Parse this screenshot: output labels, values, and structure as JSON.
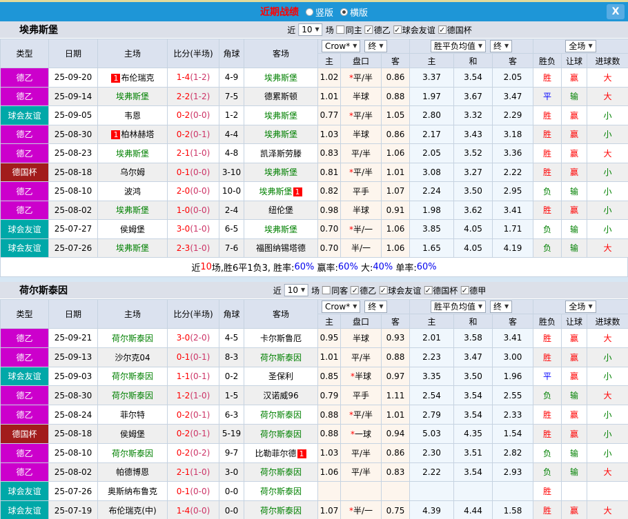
{
  "titlebar": {
    "title": "近期战绩",
    "radios": [
      {
        "label": "竖版",
        "selected": false
      },
      {
        "label": "横版",
        "selected": true
      }
    ],
    "close_icon": "X"
  },
  "headers": {
    "type": "类型",
    "date": "日期",
    "home": "主场",
    "score": "比分(半场)",
    "corner": "角球",
    "away": "客场",
    "odds_company": "Crow*",
    "odds_final": "终",
    "mean_group": "胜平负均值",
    "mean_final": "终",
    "fullmatch": "全场",
    "odds_home": "主",
    "odds_handicap": "盘口",
    "odds_away": "客",
    "mean_home": "主",
    "mean_draw": "和",
    "mean_away": "客",
    "wdl": "胜负",
    "handicap_result": "让球",
    "goals": "进球数"
  },
  "check_glyph": "✓",
  "arrow_glyph": "▼",
  "type_colors": {
    "德乙": "#CC00CC",
    "球会友谊": "#00A8A8",
    "德国杯": "#A21C1C",
    "德甲": "#CC00CC"
  },
  "result_colors": {
    "胜": "red",
    "平": "blue",
    "负": "green",
    "赢": "red",
    "输": "green",
    "大": "red",
    "小": "green"
  },
  "summary_colors": {
    "black": "#000000",
    "red": "#FF0000",
    "blue": "#0000EE"
  },
  "sections": [
    {
      "team": "埃弗斯堡",
      "filter": {
        "near_label": "近",
        "near_value": "10",
        "games_label": "场",
        "same_label": "同主",
        "same_checked": false,
        "leagues": [
          {
            "label": "德乙",
            "checked": true
          },
          {
            "label": "球会友谊",
            "checked": true
          },
          {
            "label": "德国杯",
            "checked": true
          }
        ]
      },
      "rows": [
        {
          "type": "德乙",
          "date": "25-09-20",
          "home": {
            "name": "布伦瑞克",
            "badge": "1",
            "pos": "before",
            "green": false
          },
          "score": "1-4",
          "half": "(1-2)",
          "corner": "4-9",
          "away": {
            "name": "埃弗斯堡",
            "green": true
          },
          "odds": {
            "h": "1.02",
            "star": true,
            "pk": "平/半",
            "a": "0.86"
          },
          "mean": [
            "3.37",
            "3.54",
            "2.05"
          ],
          "res": [
            "胜",
            "赢",
            "大"
          ]
        },
        {
          "type": "德乙",
          "date": "25-09-14",
          "home": {
            "name": "埃弗斯堡",
            "green": true
          },
          "score": "2-2",
          "half": "(1-2)",
          "corner": "7-5",
          "away": {
            "name": "德累斯顿",
            "green": false
          },
          "odds": {
            "h": "1.01",
            "star": false,
            "pk": "半球",
            "a": "0.88"
          },
          "mean": [
            "1.97",
            "3.67",
            "3.47"
          ],
          "res": [
            "平",
            "输",
            "大"
          ]
        },
        {
          "type": "球会友谊",
          "date": "25-09-05",
          "home": {
            "name": "韦恩",
            "green": false
          },
          "score": "0-2",
          "half": "(0-0)",
          "corner": "1-2",
          "away": {
            "name": "埃弗斯堡",
            "green": true
          },
          "odds": {
            "h": "0.77",
            "star": true,
            "pk": "平/半",
            "a": "1.05"
          },
          "mean": [
            "2.80",
            "3.32",
            "2.29"
          ],
          "res": [
            "胜",
            "赢",
            "小"
          ]
        },
        {
          "type": "德乙",
          "date": "25-08-30",
          "home": {
            "name": "柏林赫塔",
            "badge": "1",
            "pos": "before",
            "green": false
          },
          "score": "0-2",
          "half": "(0-1)",
          "corner": "4-4",
          "away": {
            "name": "埃弗斯堡",
            "green": true
          },
          "odds": {
            "h": "1.03",
            "star": false,
            "pk": "半球",
            "a": "0.86"
          },
          "mean": [
            "2.17",
            "3.43",
            "3.18"
          ],
          "res": [
            "胜",
            "赢",
            "小"
          ]
        },
        {
          "type": "德乙",
          "date": "25-08-23",
          "home": {
            "name": "埃弗斯堡",
            "green": true
          },
          "score": "2-1",
          "half": "(1-0)",
          "corner": "4-8",
          "away": {
            "name": "凯泽斯劳滕",
            "green": false
          },
          "odds": {
            "h": "0.83",
            "star": false,
            "pk": "平/半",
            "a": "1.06"
          },
          "mean": [
            "2.05",
            "3.52",
            "3.36"
          ],
          "res": [
            "胜",
            "赢",
            "大"
          ]
        },
        {
          "type": "德国杯",
          "date": "25-08-18",
          "home": {
            "name": "乌尔姆",
            "green": false
          },
          "score": "0-1",
          "half": "(0-0)",
          "corner": "3-10",
          "away": {
            "name": "埃弗斯堡",
            "green": true
          },
          "odds": {
            "h": "0.81",
            "star": true,
            "pk": "平/半",
            "a": "1.01"
          },
          "mean": [
            "3.08",
            "3.27",
            "2.22"
          ],
          "res": [
            "胜",
            "赢",
            "小"
          ]
        },
        {
          "type": "德乙",
          "date": "25-08-10",
          "home": {
            "name": "波鸿",
            "green": false
          },
          "score": "2-0",
          "half": "(0-0)",
          "corner": "10-0",
          "away": {
            "name": "埃弗斯堡",
            "badge": "1",
            "pos": "after",
            "green": true
          },
          "odds": {
            "h": "0.82",
            "star": false,
            "pk": "平手",
            "a": "1.07"
          },
          "mean": [
            "2.24",
            "3.50",
            "2.95"
          ],
          "res": [
            "负",
            "输",
            "小"
          ]
        },
        {
          "type": "德乙",
          "date": "25-08-02",
          "home": {
            "name": "埃弗斯堡",
            "green": true
          },
          "score": "1-0",
          "half": "(0-0)",
          "corner": "2-4",
          "away": {
            "name": "纽伦堡",
            "green": false
          },
          "odds": {
            "h": "0.98",
            "star": false,
            "pk": "半球",
            "a": "0.91"
          },
          "mean": [
            "1.98",
            "3.62",
            "3.41"
          ],
          "res": [
            "胜",
            "赢",
            "小"
          ]
        },
        {
          "type": "球会友谊",
          "date": "25-07-27",
          "home": {
            "name": "侯姆堡",
            "green": false
          },
          "score": "3-0",
          "half": "(1-0)",
          "corner": "6-5",
          "away": {
            "name": "埃弗斯堡",
            "green": true
          },
          "odds": {
            "h": "0.70",
            "star": true,
            "pk": "半/一",
            "a": "1.06"
          },
          "mean": [
            "3.85",
            "4.05",
            "1.71"
          ],
          "res": [
            "负",
            "输",
            "小"
          ]
        },
        {
          "type": "球会友谊",
          "date": "25-07-26",
          "home": {
            "name": "埃弗斯堡",
            "green": true
          },
          "score": "2-3",
          "half": "(1-0)",
          "corner": "7-6",
          "away": {
            "name": "福图纳锡塔德",
            "green": false
          },
          "odds": {
            "h": "0.70",
            "star": false,
            "pk": "半/一",
            "a": "1.06"
          },
          "mean": [
            "1.65",
            "4.05",
            "4.19"
          ],
          "res": [
            "负",
            "输",
            "大"
          ]
        }
      ],
      "summary": [
        {
          "t": "近",
          "c": "black"
        },
        {
          "t": "10",
          "c": "red"
        },
        {
          "t": "场,胜6平1负3, 胜率:",
          "c": "black"
        },
        {
          "t": "60%",
          "c": "blue"
        },
        {
          "t": " 赢率:",
          "c": "black"
        },
        {
          "t": "60%",
          "c": "blue"
        },
        {
          "t": " 大:",
          "c": "black"
        },
        {
          "t": "40%",
          "c": "blue"
        },
        {
          "t": " 单率:",
          "c": "black"
        },
        {
          "t": "60%",
          "c": "blue"
        }
      ]
    },
    {
      "team": "荷尔斯泰因",
      "filter": {
        "near_label": "近",
        "near_value": "10",
        "games_label": "场",
        "same_label": "同客",
        "same_checked": false,
        "leagues": [
          {
            "label": "德乙",
            "checked": true
          },
          {
            "label": "球会友谊",
            "checked": true
          },
          {
            "label": "德国杯",
            "checked": true
          },
          {
            "label": "德甲",
            "checked": true
          }
        ]
      },
      "rows": [
        {
          "type": "德乙",
          "date": "25-09-21",
          "home": {
            "name": "荷尔斯泰因",
            "green": true
          },
          "score": "3-0",
          "half": "(2-0)",
          "corner": "4-5",
          "away": {
            "name": "卡尔斯鲁厄",
            "green": false
          },
          "odds": {
            "h": "0.95",
            "star": false,
            "pk": "半球",
            "a": "0.93"
          },
          "mean": [
            "2.01",
            "3.58",
            "3.41"
          ],
          "res": [
            "胜",
            "赢",
            "大"
          ]
        },
        {
          "type": "德乙",
          "date": "25-09-13",
          "home": {
            "name": "沙尔克04",
            "green": false
          },
          "score": "0-1",
          "half": "(0-1)",
          "corner": "8-3",
          "away": {
            "name": "荷尔斯泰因",
            "green": true
          },
          "odds": {
            "h": "1.01",
            "star": false,
            "pk": "平/半",
            "a": "0.88"
          },
          "mean": [
            "2.23",
            "3.47",
            "3.00"
          ],
          "res": [
            "胜",
            "赢",
            "小"
          ]
        },
        {
          "type": "球会友谊",
          "date": "25-09-03",
          "home": {
            "name": "荷尔斯泰因",
            "green": true
          },
          "score": "1-1",
          "half": "(0-1)",
          "corner": "0-2",
          "away": {
            "name": "圣保利",
            "green": false
          },
          "odds": {
            "h": "0.85",
            "star": true,
            "pk": "半球",
            "a": "0.97"
          },
          "mean": [
            "3.35",
            "3.50",
            "1.96"
          ],
          "res": [
            "平",
            "赢",
            "小"
          ]
        },
        {
          "type": "德乙",
          "date": "25-08-30",
          "home": {
            "name": "荷尔斯泰因",
            "green": true
          },
          "score": "1-2",
          "half": "(1-0)",
          "corner": "1-5",
          "away": {
            "name": "汉诺威96",
            "green": false
          },
          "odds": {
            "h": "0.79",
            "star": false,
            "pk": "平手",
            "a": "1.11"
          },
          "mean": [
            "2.54",
            "3.54",
            "2.55"
          ],
          "res": [
            "负",
            "输",
            "大"
          ]
        },
        {
          "type": "德乙",
          "date": "25-08-24",
          "home": {
            "name": "菲尔特",
            "green": false
          },
          "score": "0-2",
          "half": "(0-1)",
          "corner": "6-3",
          "away": {
            "name": "荷尔斯泰因",
            "green": true
          },
          "odds": {
            "h": "0.88",
            "star": true,
            "pk": "平/半",
            "a": "1.01"
          },
          "mean": [
            "2.79",
            "3.54",
            "2.33"
          ],
          "res": [
            "胜",
            "赢",
            "小"
          ]
        },
        {
          "type": "德国杯",
          "date": "25-08-18",
          "home": {
            "name": "侯姆堡",
            "green": false
          },
          "score": "0-2",
          "half": "(0-1)",
          "corner": "5-19",
          "away": {
            "name": "荷尔斯泰因",
            "green": true
          },
          "odds": {
            "h": "0.88",
            "star": true,
            "pk": "一球",
            "a": "0.94"
          },
          "mean": [
            "5.03",
            "4.35",
            "1.54"
          ],
          "res": [
            "胜",
            "赢",
            "小"
          ]
        },
        {
          "type": "德乙",
          "date": "25-08-10",
          "home": {
            "name": "荷尔斯泰因",
            "green": true
          },
          "score": "0-2",
          "half": "(0-2)",
          "corner": "9-7",
          "away": {
            "name": "比勒菲尔德",
            "badge": "1",
            "pos": "after",
            "green": false
          },
          "odds": {
            "h": "1.03",
            "star": false,
            "pk": "平/半",
            "a": "0.86"
          },
          "mean": [
            "2.30",
            "3.51",
            "2.82"
          ],
          "res": [
            "负",
            "输",
            "小"
          ]
        },
        {
          "type": "德乙",
          "date": "25-08-02",
          "home": {
            "name": "帕德博恩",
            "green": false
          },
          "score": "2-1",
          "half": "(1-0)",
          "corner": "3-0",
          "away": {
            "name": "荷尔斯泰因",
            "green": true
          },
          "odds": {
            "h": "1.06",
            "star": false,
            "pk": "平/半",
            "a": "0.83"
          },
          "mean": [
            "2.22",
            "3.54",
            "2.93"
          ],
          "res": [
            "负",
            "输",
            "大"
          ]
        },
        {
          "type": "球会友谊",
          "date": "25-07-26",
          "home": {
            "name": "奥斯纳布鲁克",
            "green": false
          },
          "score": "0-1",
          "half": "(0-0)",
          "corner": "0-0",
          "away": {
            "name": "荷尔斯泰因",
            "green": true
          },
          "odds": {
            "h": "",
            "star": false,
            "pk": "",
            "a": ""
          },
          "mean": [
            "",
            "",
            ""
          ],
          "res": [
            "胜",
            "",
            ""
          ]
        },
        {
          "type": "球会友谊",
          "date": "25-07-19",
          "home": {
            "name": "布伦瑞克(中)",
            "green": false
          },
          "score": "1-4",
          "half": "(0-0)",
          "corner": "0-0",
          "away": {
            "name": "荷尔斯泰因",
            "green": true
          },
          "odds": {
            "h": "1.07",
            "star": true,
            "pk": "半/一",
            "a": "0.75"
          },
          "mean": [
            "4.39",
            "4.44",
            "1.58"
          ],
          "res": [
            "胜",
            "赢",
            "大"
          ]
        }
      ],
      "summary": null
    }
  ]
}
